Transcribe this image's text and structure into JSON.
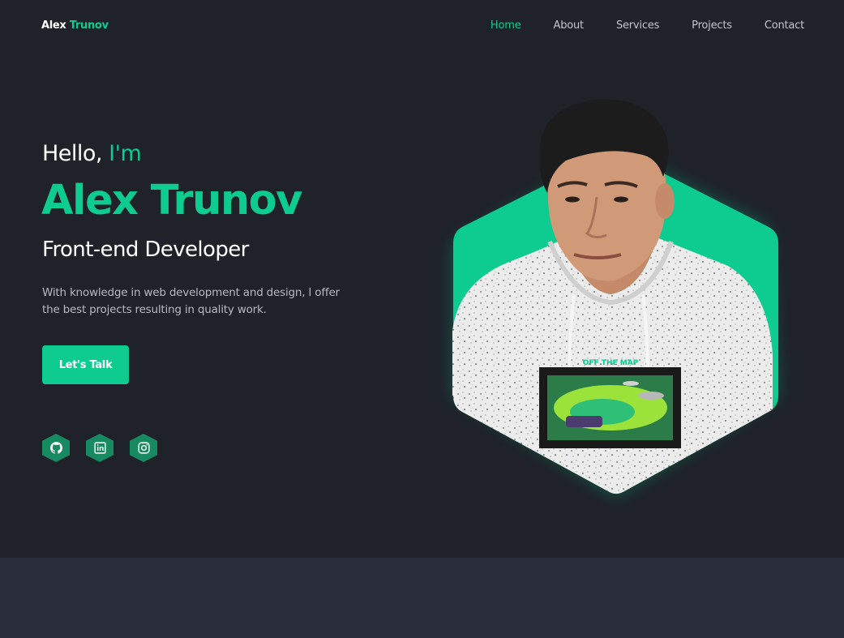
{
  "brand": {
    "first": "Alex",
    "last": "Trunov"
  },
  "nav": {
    "items": [
      {
        "label": "Home",
        "active": true
      },
      {
        "label": "About",
        "active": false
      },
      {
        "label": "Services",
        "active": false
      },
      {
        "label": "Projects",
        "active": false
      },
      {
        "label": "Contact",
        "active": false
      }
    ]
  },
  "hero": {
    "greeting": "Hello,",
    "greeting_accent": "I'm",
    "name": "Alex Trunov",
    "role": "Front-end Developer",
    "description": "With knowledge in web development and design, I offer the best projects resulting in quality work.",
    "cta_label": "Let's Talk",
    "print_text": "OFF THE MAP"
  },
  "socials": [
    {
      "name": "github-icon"
    },
    {
      "name": "linkedin-icon"
    },
    {
      "name": "instagram-icon"
    }
  ],
  "colors": {
    "accent": "#0ecb8f",
    "background": "#1f2229",
    "section_background": "#292c39",
    "social_bg": "#188a62"
  }
}
